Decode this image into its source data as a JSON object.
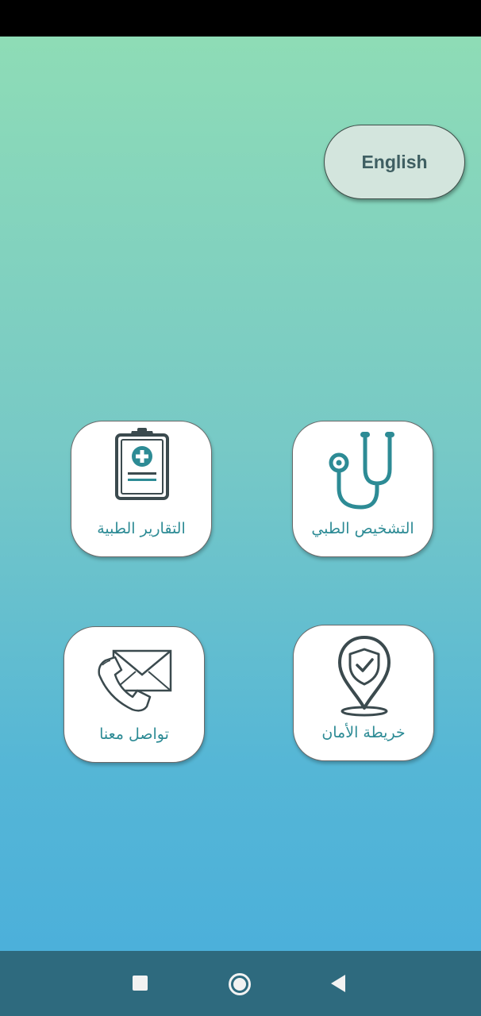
{
  "language_button": {
    "label": "English"
  },
  "cards": {
    "reports": {
      "label": "التقارير الطبية",
      "icon": "clipboard-medical-icon"
    },
    "diagnosis": {
      "label": "التشخيص الطبي",
      "icon": "stethoscope-icon"
    },
    "contact": {
      "label": "تواصل معنا",
      "icon": "phone-mail-icon"
    },
    "safety": {
      "label": "خريطة الأمان",
      "icon": "location-shield-icon"
    }
  },
  "navigation": {
    "recent": "recent-apps-icon",
    "home": "home-icon",
    "back": "back-icon"
  },
  "colors": {
    "label_teal": "#2d8b95",
    "icon_dark": "#3b4a4e",
    "gradient_top": "#8edcb6",
    "gradient_bottom": "#4cb0da",
    "nav_bar": "#2e6a7e"
  }
}
